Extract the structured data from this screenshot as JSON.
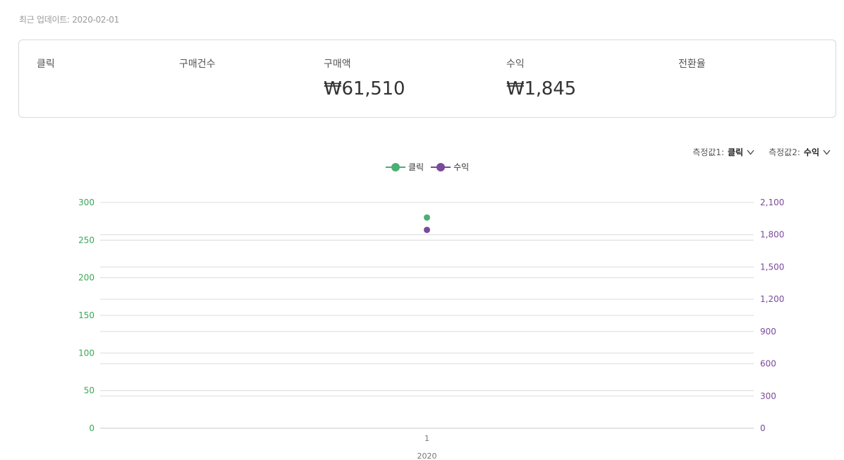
{
  "header": {
    "last_updated": "최근 업데이트: 2020-02-01"
  },
  "summary": {
    "metrics": [
      {
        "label": "클릭",
        "value": ""
      },
      {
        "label": "구매건수",
        "value": ""
      },
      {
        "label": "구매액",
        "value": "₩61,510"
      },
      {
        "label": "수익",
        "value": "₩1,845"
      },
      {
        "label": "전환율",
        "value": ""
      }
    ]
  },
  "selectors": [
    {
      "label": "측정값1:",
      "value": "클릭"
    },
    {
      "label": "측정값2:",
      "value": "수익"
    }
  ],
  "icons": {
    "chevron": "chevron-down-icon"
  },
  "colors": {
    "series1": "#4caf72",
    "series2": "#7b4a9a",
    "grid": "#dcdcdc",
    "border": "#d9d9d9"
  },
  "chart_data": {
    "type": "scatter",
    "x": [
      "1"
    ],
    "x_group_label": "2020",
    "series": [
      {
        "name": "클릭",
        "axis": "left",
        "values": [
          280
        ]
      },
      {
        "name": "수익",
        "axis": "right",
        "values": [
          1845
        ]
      }
    ],
    "y_left": {
      "ticks": [
        0,
        50,
        100,
        150,
        200,
        250,
        300
      ],
      "labels": [
        "0",
        "50",
        "100",
        "150",
        "200",
        "250",
        "300"
      ],
      "range": [
        0,
        300
      ]
    },
    "y_right": {
      "ticks": [
        0,
        300,
        600,
        900,
        1200,
        1500,
        1800,
        2100
      ],
      "labels": [
        "0",
        "300",
        "600",
        "900",
        "1,200",
        "1,500",
        "1,800",
        "2,100"
      ],
      "range": [
        0,
        2100
      ]
    },
    "grid": true,
    "legend": "top-center"
  }
}
